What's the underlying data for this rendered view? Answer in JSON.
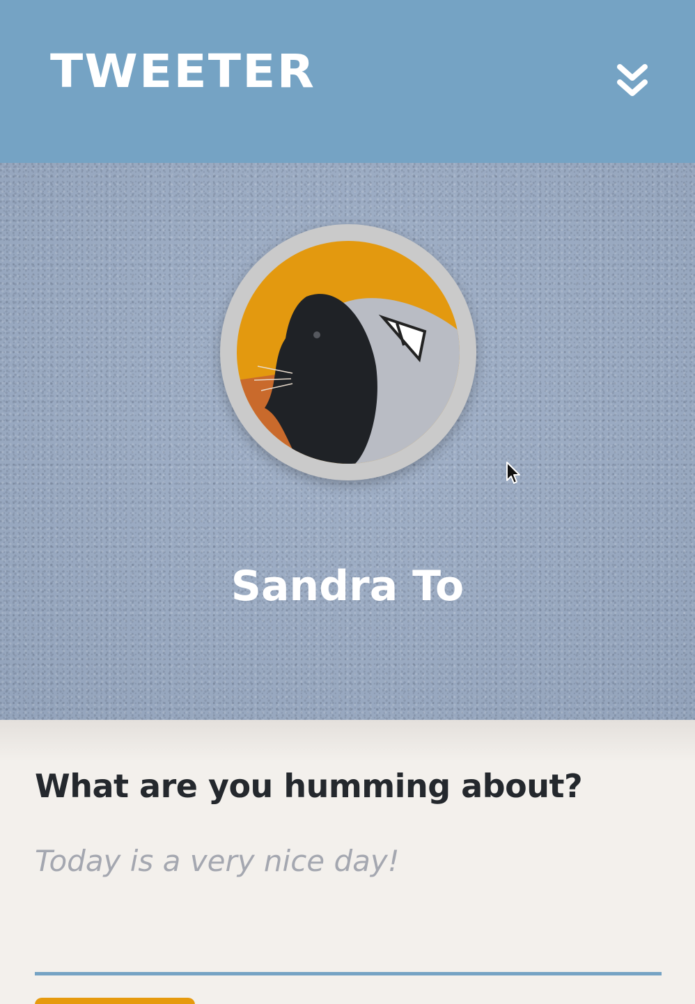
{
  "header": {
    "brand": "TWEETER",
    "menu_icon": "double-chevron-down-icon"
  },
  "profile": {
    "display_name": "Sandra To",
    "avatar_icon": "avatar-image"
  },
  "composer": {
    "heading": "What are you humming about?",
    "placeholder": "Today is a very nice day!",
    "value": "",
    "submit_label": ""
  },
  "colors": {
    "header_bg": "#75a3c4",
    "accent": "#e69a0e",
    "page_bg": "#f3f0ec",
    "heading_text": "#24282d",
    "placeholder_text": "#a4a7b0"
  }
}
